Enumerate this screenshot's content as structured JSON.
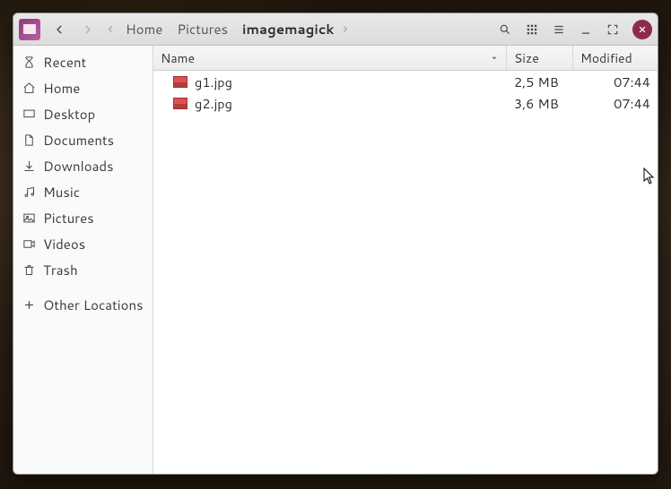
{
  "breadcrumb": {
    "home": "Home",
    "pictures": "Pictures",
    "current": "imagemagick"
  },
  "columns": {
    "name": "Name",
    "size": "Size",
    "modified": "Modified"
  },
  "sidebar": {
    "recent": "Recent",
    "home": "Home",
    "desktop": "Desktop",
    "documents": "Documents",
    "downloads": "Downloads",
    "music": "Music",
    "pictures": "Pictures",
    "videos": "Videos",
    "trash": "Trash",
    "other": "Other Locations"
  },
  "files": [
    {
      "name": "g1.jpg",
      "size": "2,5 MB",
      "modified": "07:44"
    },
    {
      "name": "g2.jpg",
      "size": "3,6 MB",
      "modified": "07:44"
    }
  ]
}
